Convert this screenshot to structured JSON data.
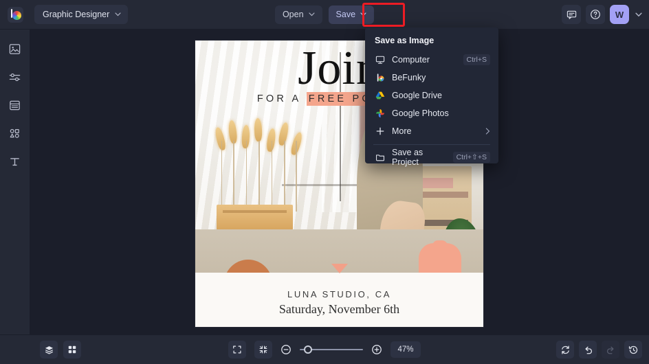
{
  "app": {
    "logo_icon": "befunky-logo-icon",
    "document_name": "Graphic Designer"
  },
  "topbar": {
    "open_label": "Open",
    "save_label": "Save",
    "chat_icon": "chat-bubble-icon",
    "help_icon": "help-circle-icon",
    "avatar_initial": "W",
    "caret_icon": "chevron-down-icon",
    "save_highlight_color": "#ec1c24"
  },
  "sidebar": {
    "items": [
      {
        "name": "image-manager",
        "icon": "image-icon"
      },
      {
        "name": "edit-adjust",
        "icon": "sliders-icon"
      },
      {
        "name": "templates",
        "icon": "layout-icon"
      },
      {
        "name": "graphics",
        "icon": "shapes-icon"
      },
      {
        "name": "text",
        "icon": "text-icon"
      }
    ]
  },
  "save_menu": {
    "title": "Save as Image",
    "items": [
      {
        "label": "Computer",
        "icon": "monitor-icon",
        "shortcut": "Ctrl+S"
      },
      {
        "label": "BeFunky",
        "icon": "befunky-icon",
        "shortcut": ""
      },
      {
        "label": "Google Drive",
        "icon": "google-drive-icon",
        "shortcut": ""
      },
      {
        "label": "Google Photos",
        "icon": "google-photos-icon",
        "shortcut": ""
      },
      {
        "label": "More",
        "icon": "plus-icon",
        "shortcut": "",
        "submenu_icon": "chevron-right-icon"
      }
    ],
    "project": {
      "label": "Save as Project",
      "icon": "folder-icon",
      "shortcut": "Ctrl+⇧+S"
    }
  },
  "canvas": {
    "poster": {
      "headline": "Join",
      "subline_plain": "FOR A ",
      "subline_highlight": "FREE POTTERY",
      "studio": "LUNA STUDIO, CA",
      "date": "Saturday, November 6th",
      "highlight_color": "#f4a58c",
      "accent_terracotta": "#ca7c4b"
    }
  },
  "bottombar": {
    "layers_icon": "layers-icon",
    "grid_icon": "grid-icon",
    "fit_icon": "fit-screen-icon",
    "fullscreen_icon": "collapse-screen-icon",
    "zoom_out_icon": "minus-circle-icon",
    "zoom_in_icon": "plus-circle-icon",
    "zoom_level": "47%",
    "reset_icon": "reset-icon",
    "undo_icon": "undo-icon",
    "redo_icon": "redo-icon",
    "history_icon": "history-clock-icon"
  }
}
